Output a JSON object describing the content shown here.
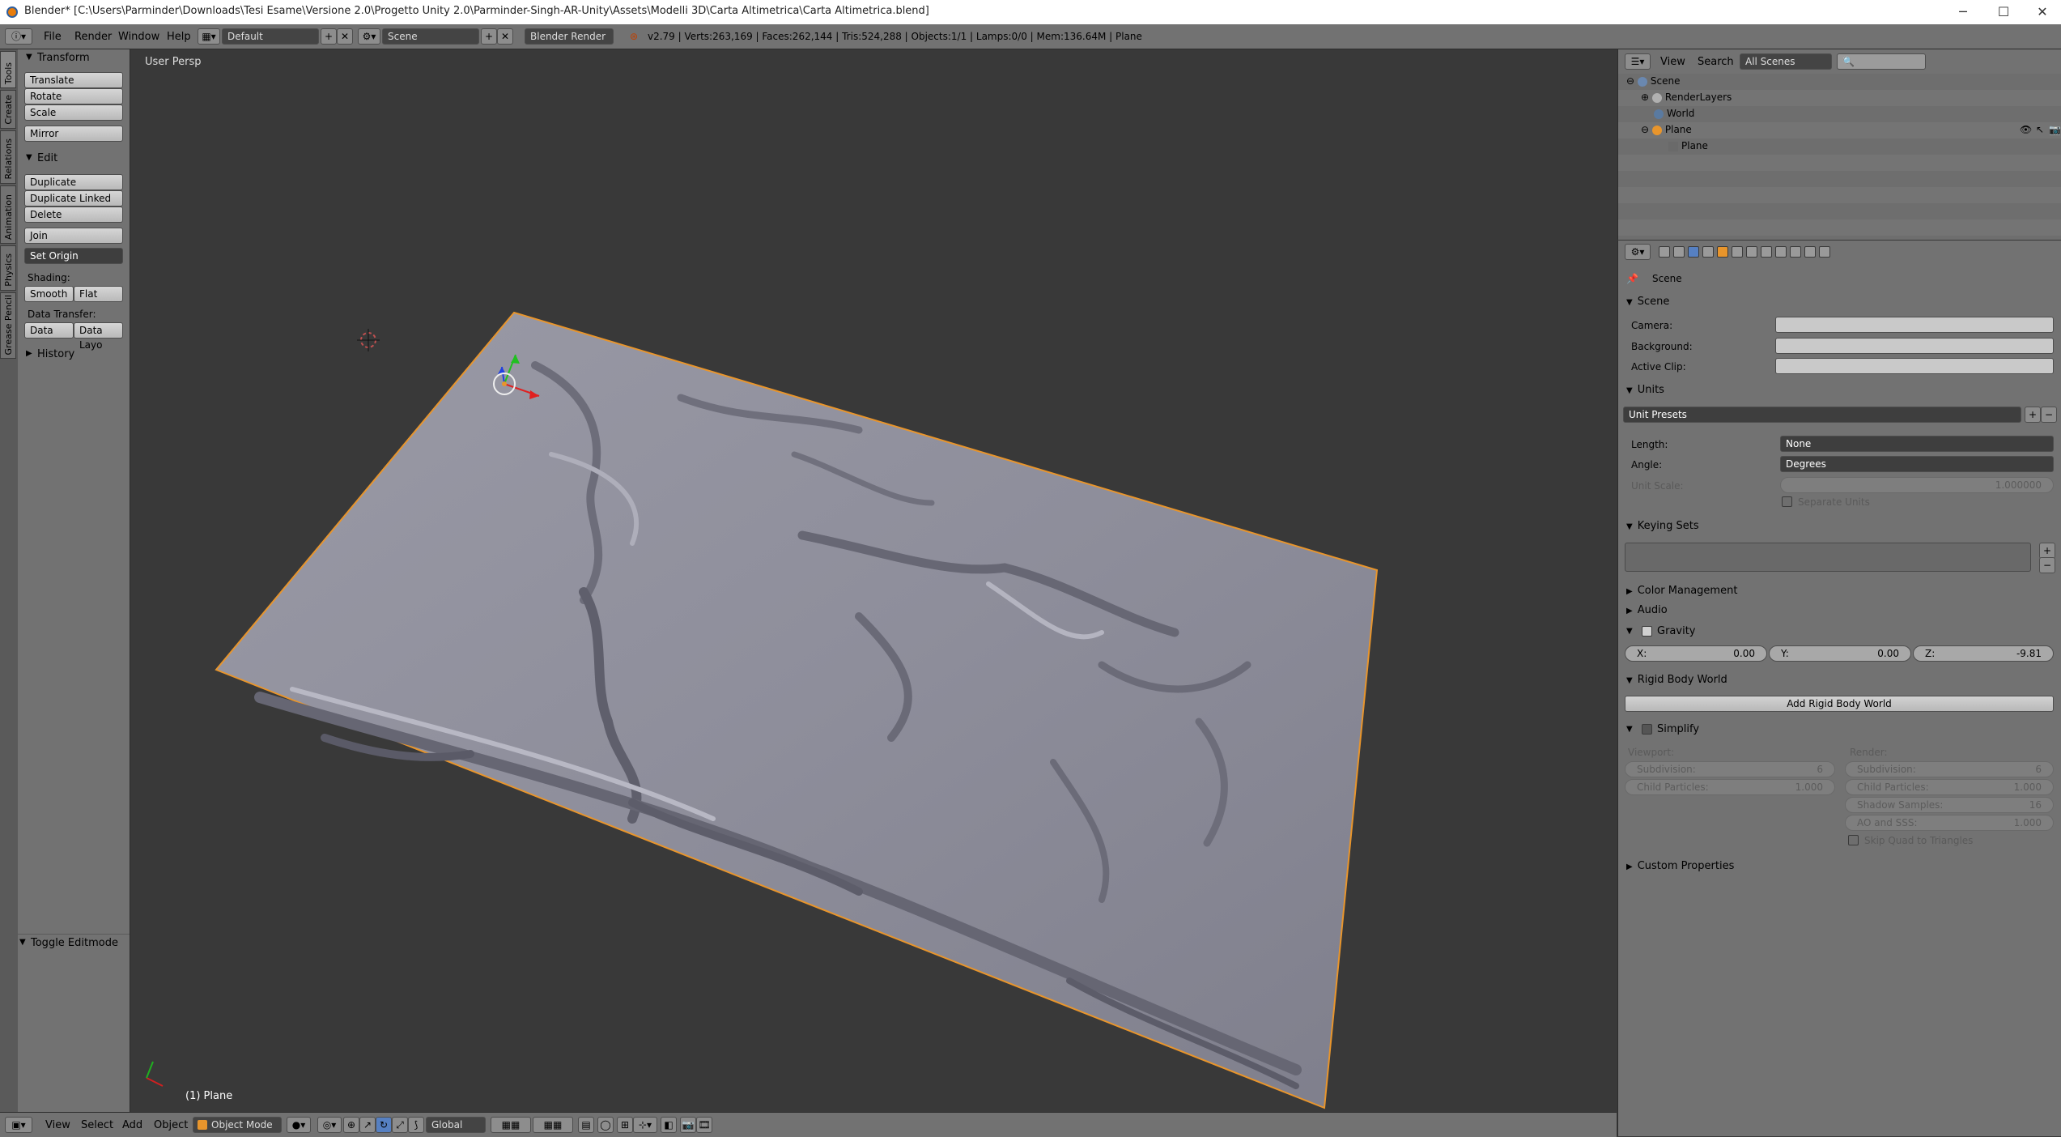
{
  "titlebar": {
    "title": "Blender* [C:\\Users\\Parminder\\Downloads\\Tesi Esame\\Versione 2.0\\Progetto Unity 2.0\\Parminder-Singh-AR-Unity\\Assets\\Modelli 3D\\Carta Altimetrica\\Carta Altimetrica.blend]",
    "minimize": "─",
    "maximize": "☐",
    "close": "✕"
  },
  "info_header": {
    "menus": [
      "File",
      "Render",
      "Window",
      "Help"
    ],
    "screen_layout": "Default",
    "scene": "Scene",
    "render_engine": "Blender Render",
    "stats": "v2.79 | Verts:263,169 | Faces:262,144 | Tris:524,288 | Objects:1/1 | Lamps:0/0 | Mem:136.64M | Plane"
  },
  "vertical_tabs": [
    "Tools",
    "Create",
    "Relations",
    "Animation",
    "Physics",
    "Grease Pencil"
  ],
  "toolshelf": {
    "transform": {
      "title": "Transform",
      "buttons": [
        "Translate",
        "Rotate",
        "Scale",
        "Mirror"
      ]
    },
    "edit": {
      "title": "Edit",
      "buttons": [
        "Duplicate",
        "Duplicate Linked",
        "Delete",
        "Join"
      ],
      "set_origin": "Set Origin",
      "shading_label": "Shading:",
      "smooth": "Smooth",
      "flat": "Flat",
      "data_transfer_label": "Data Transfer:",
      "data": "Data",
      "data_layout": "Data Layo"
    },
    "history": "History",
    "toggle_editmode": "Toggle Editmode"
  },
  "viewport": {
    "view_label": "User Persp",
    "object_label": "(1) Plane"
  },
  "bottom_header": {
    "menus": [
      "View",
      "Select",
      "Add",
      "Object"
    ],
    "mode": "Object Mode",
    "orientation": "Global"
  },
  "outliner": {
    "view": "View",
    "search": "Search",
    "display": "All Scenes",
    "tree": [
      "Scene",
      "RenderLayers",
      "World",
      "Plane",
      "Plane"
    ]
  },
  "properties": {
    "context": "Scene",
    "scene_section": "Scene",
    "camera_label": "Camera:",
    "background_label": "Background:",
    "active_clip_label": "Active Clip:",
    "units_section": "Units",
    "unit_presets": "Unit Presets",
    "length_label": "Length:",
    "length_value": "None",
    "angle_label": "Angle:",
    "angle_value": "Degrees",
    "unit_scale_label": "Unit Scale:",
    "unit_scale_value": "1.000000",
    "separate_units": "Separate Units",
    "keying_sets": "Keying Sets",
    "color_management": "Color Management",
    "audio": "Audio",
    "gravity": "Gravity",
    "gravity_x_label": "X:",
    "gravity_x": "0.00",
    "gravity_y_label": "Y:",
    "gravity_y": "0.00",
    "gravity_z_label": "Z:",
    "gravity_z": "-9.81",
    "rigid_body_world": "Rigid Body World",
    "add_rigid_body_world": "Add Rigid Body World",
    "simplify": "Simplify",
    "viewport_label": "Viewport:",
    "render_label": "Render:",
    "subdivision_label": "Subdivision:",
    "subdivision_viewport": "6",
    "subdivision_render": "6",
    "child_particles_label": "Child Particles:",
    "child_particles_viewport": "1.000",
    "child_particles_render": "1.000",
    "shadow_samples_label": "Shadow Samples:",
    "shadow_samples": "16",
    "ao_sss_label": "AO and SSS:",
    "ao_sss": "1.000",
    "skip_quad": "Skip Quad to Triangles",
    "custom_properties": "Custom Properties"
  },
  "colors": {
    "viewport_bg": "#393939",
    "panel_bg": "#727272",
    "plane_surface": "#8c8c99",
    "selection_outline": "#e8952c"
  }
}
